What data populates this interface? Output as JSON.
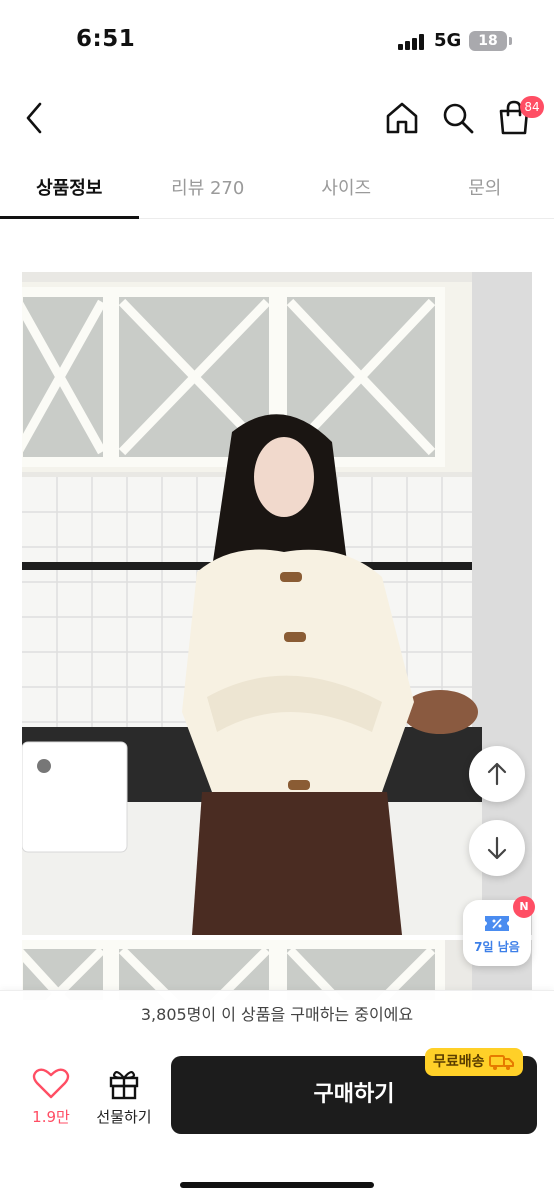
{
  "status_bar": {
    "time": "6:51",
    "network": "5G",
    "battery": "18"
  },
  "header": {
    "cart_count": "84"
  },
  "tabs": [
    {
      "label": "상품정보",
      "active": true
    },
    {
      "label": "리뷰 270",
      "active": false
    },
    {
      "label": "사이즈",
      "active": false
    },
    {
      "label": "문의",
      "active": false
    }
  ],
  "coupon": {
    "badge": "N",
    "label": "7일 남음"
  },
  "buying_banner": "3,805명이 이 상품을 구매하는 중이에요",
  "bottom_bar": {
    "like_count": "1.9만",
    "gift_label": "선물하기",
    "buy_label": "구매하기",
    "free_shipping_label": "무료배송"
  },
  "colors": {
    "accent": "#ff4e64",
    "buy_button": "#1c1c1c",
    "free_shipping": "#ffd028"
  }
}
